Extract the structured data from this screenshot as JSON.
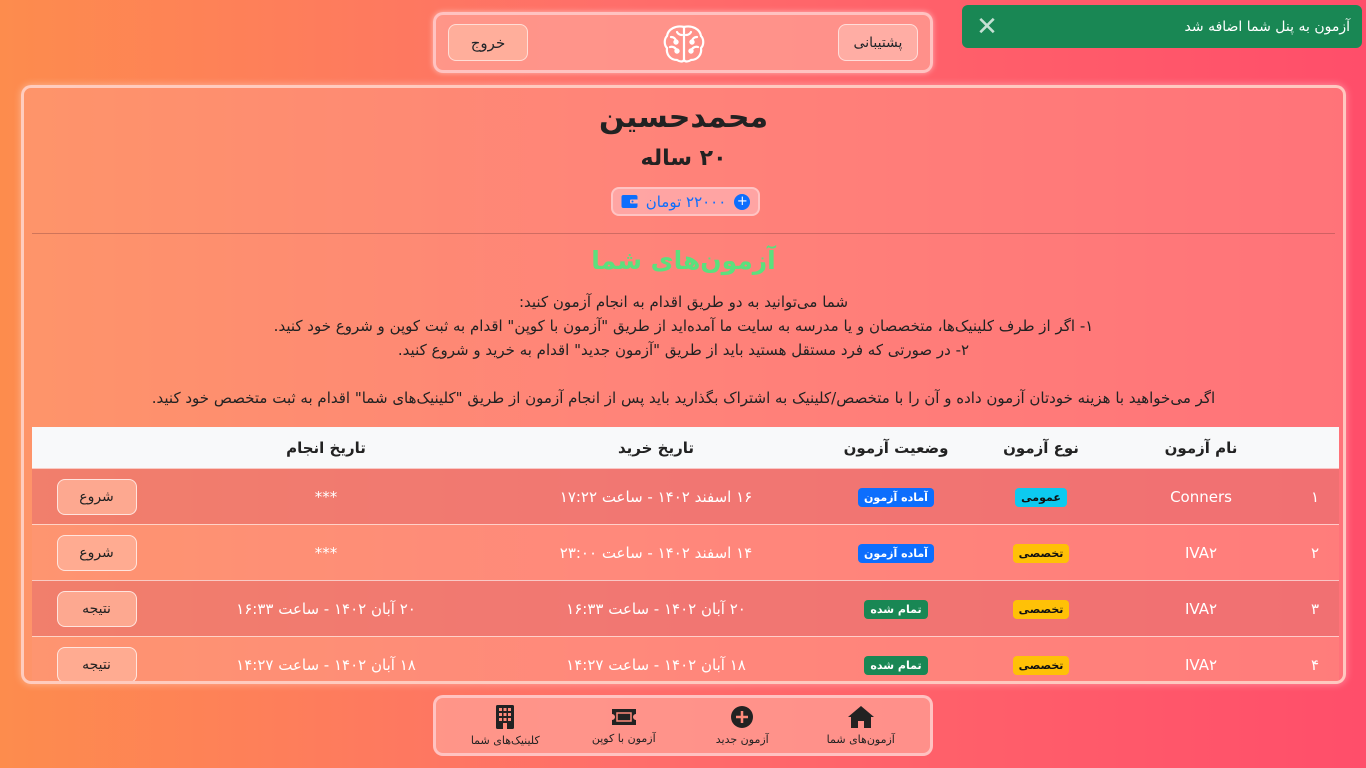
{
  "header": {
    "exit_label": "خروج",
    "support_label": "پشتیبانی",
    "logo_icon": "brain-icon"
  },
  "toast": {
    "message": "آزمون به پنل شما اضافه شد",
    "close_icon": "close-icon",
    "color": "#198754"
  },
  "profile": {
    "name": "محمدحسین",
    "age": "۲۰ ساله",
    "balance": "۲۲۰۰۰ تومان"
  },
  "exams_section": {
    "title": "آزمون‌های شما",
    "lines": [
      "شما می‌توانید به دو طریق اقدام به انجام آزمون کنید:",
      "۱- اگر از طرف کلینیک‌ها، متخصصان و یا مدرسه به سایت ما آمده‌اید از طریق \"آزمون با کوپن\" اقدام به ثبت کوپن و شروع خود کنید.",
      "۲- در صورتی که فرد مستقل هستید باید از طریق \"آزمون جدید\" اقدام به خرید و شروع کنید.",
      "اگر می‌خواهید با هزینه خودتان آزمون داده و آن را با متخصص/کلینیک به اشتراک بگذارید باید پس از انجام آزمون از طریق \"کلینیک‌های شما\" اقدام به ثبت متخصص خود کنید."
    ]
  },
  "table": {
    "headers": {
      "name": "نام آزمون",
      "type": "نوع آزمون",
      "status": "وضعیت آزمون",
      "purchase_date": "تاریخ خرید",
      "done_date": "تاریخ انجام"
    },
    "rows": [
      {
        "num": "۱",
        "name": "Conners",
        "type": "عمومی",
        "type_kind": "general",
        "status": "آماده آزمون",
        "status_kind": "ready",
        "purchase_date": "۱۶ اسفند ۱۴۰۲ - ساعت ۱۷:۲۲",
        "done_date": "***",
        "action": "شروع"
      },
      {
        "num": "۲",
        "name": "IVA۲",
        "type": "تخصصی",
        "type_kind": "special",
        "status": "آماده آزمون",
        "status_kind": "ready",
        "purchase_date": "۱۴ اسفند ۱۴۰۲ - ساعت ۲۳:۰۰",
        "done_date": "***",
        "action": "شروع"
      },
      {
        "num": "۳",
        "name": "IVA۲",
        "type": "تخصصی",
        "type_kind": "special",
        "status": "تمام شده",
        "status_kind": "done",
        "purchase_date": "۲۰ آبان ۱۴۰۲ - ساعت ۱۶:۳۳",
        "done_date": "۲۰ آبان ۱۴۰۲ - ساعت ۱۶:۳۳",
        "action": "نتیجه"
      },
      {
        "num": "۴",
        "name": "IVA۲",
        "type": "تخصصی",
        "type_kind": "special",
        "status": "تمام شده",
        "status_kind": "done",
        "purchase_date": "۱۸ آبان ۱۴۰۲ - ساعت ۱۴:۲۷",
        "done_date": "۱۸ آبان ۱۴۰۲ - ساعت ۱۴:۲۷",
        "action": "نتیجه"
      }
    ]
  },
  "bottom_nav": [
    {
      "label": "آزمون‌های شما",
      "icon": "home-icon"
    },
    {
      "label": "آزمون جدید",
      "icon": "plus-circle-icon"
    },
    {
      "label": "آزمون با کوپن",
      "icon": "ticket-icon"
    },
    {
      "label": "کلینیک‌های شما",
      "icon": "building-icon"
    }
  ]
}
